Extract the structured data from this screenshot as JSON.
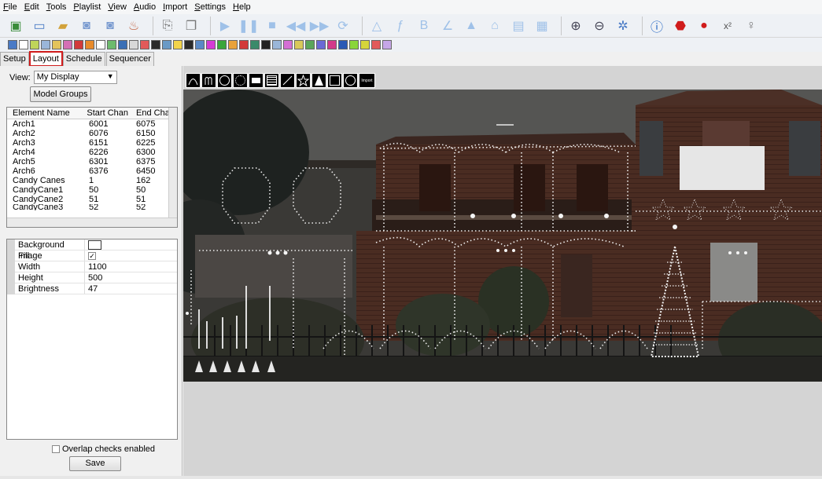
{
  "menu": [
    "File",
    "Edit",
    "Tools",
    "Playlist",
    "View",
    "Audio",
    "Import",
    "Settings",
    "Help"
  ],
  "toolbar_icons": [
    "open-icon",
    "new-icon",
    "folder-icon",
    "save-icon",
    "save-as-icon",
    "clean-icon",
    "paste-icon",
    "copy-icon",
    "play-icon",
    "pause-icon",
    "stop-icon",
    "rewind-icon",
    "forward-icon",
    "repeat-icon",
    "outline-icon",
    "effects-icon",
    "bulb-icon",
    "zoom-in-icon",
    "zoom-out-icon",
    "settings-icon",
    "info-icon",
    "stop-sign-icon",
    "record-icon",
    "x-icon",
    "lightbulb-icon"
  ],
  "tabs": [
    {
      "label": "Setup"
    },
    {
      "label": "Layout",
      "active": true
    },
    {
      "label": "Schedule"
    },
    {
      "label": "Sequencer"
    }
  ],
  "view": {
    "label": "View:",
    "value": "My Display"
  },
  "model_groups_label": "Model Groups",
  "elements_table": {
    "headers": [
      "Element Name",
      "Start Chan",
      "End Cha"
    ],
    "rows": [
      [
        "Arch1",
        "6001",
        "6075"
      ],
      [
        "Arch2",
        "6076",
        "6150"
      ],
      [
        "Arch3",
        "6151",
        "6225"
      ],
      [
        "Arch4",
        "6226",
        "6300"
      ],
      [
        "Arch5",
        "6301",
        "6375"
      ],
      [
        "Arch6",
        "6376",
        "6450"
      ],
      [
        "Candy Canes",
        "1",
        "162"
      ],
      [
        "CandyCane1",
        "50",
        "50"
      ],
      [
        "CandyCane2",
        "51",
        "51"
      ],
      [
        "CandyCane3",
        "52",
        "52"
      ]
    ]
  },
  "properties": [
    {
      "key": "Background Image",
      "type": "color",
      "value": ""
    },
    {
      "key": "Fill",
      "type": "checkbox",
      "value": true
    },
    {
      "key": "Width",
      "type": "text",
      "value": "1100"
    },
    {
      "key": "Height",
      "type": "text",
      "value": "500"
    },
    {
      "key": "Brightness",
      "type": "text",
      "value": "47"
    }
  ],
  "overlap_label": "Overlap checks enabled",
  "save_label": "Save",
  "model_tools": [
    "arch-tool",
    "candy-cane-tool",
    "circle-tool",
    "star-wreath-tool",
    "matrix-tool",
    "single-line-tool",
    "poly-line-tool",
    "star-tool",
    "tree-tool",
    "window-frame-tool",
    "wreath-tool"
  ],
  "import_label": "Import",
  "colors": {
    "selected_tab_outline": "#d01c1c",
    "canvas_bg": "#d4d4d4"
  }
}
